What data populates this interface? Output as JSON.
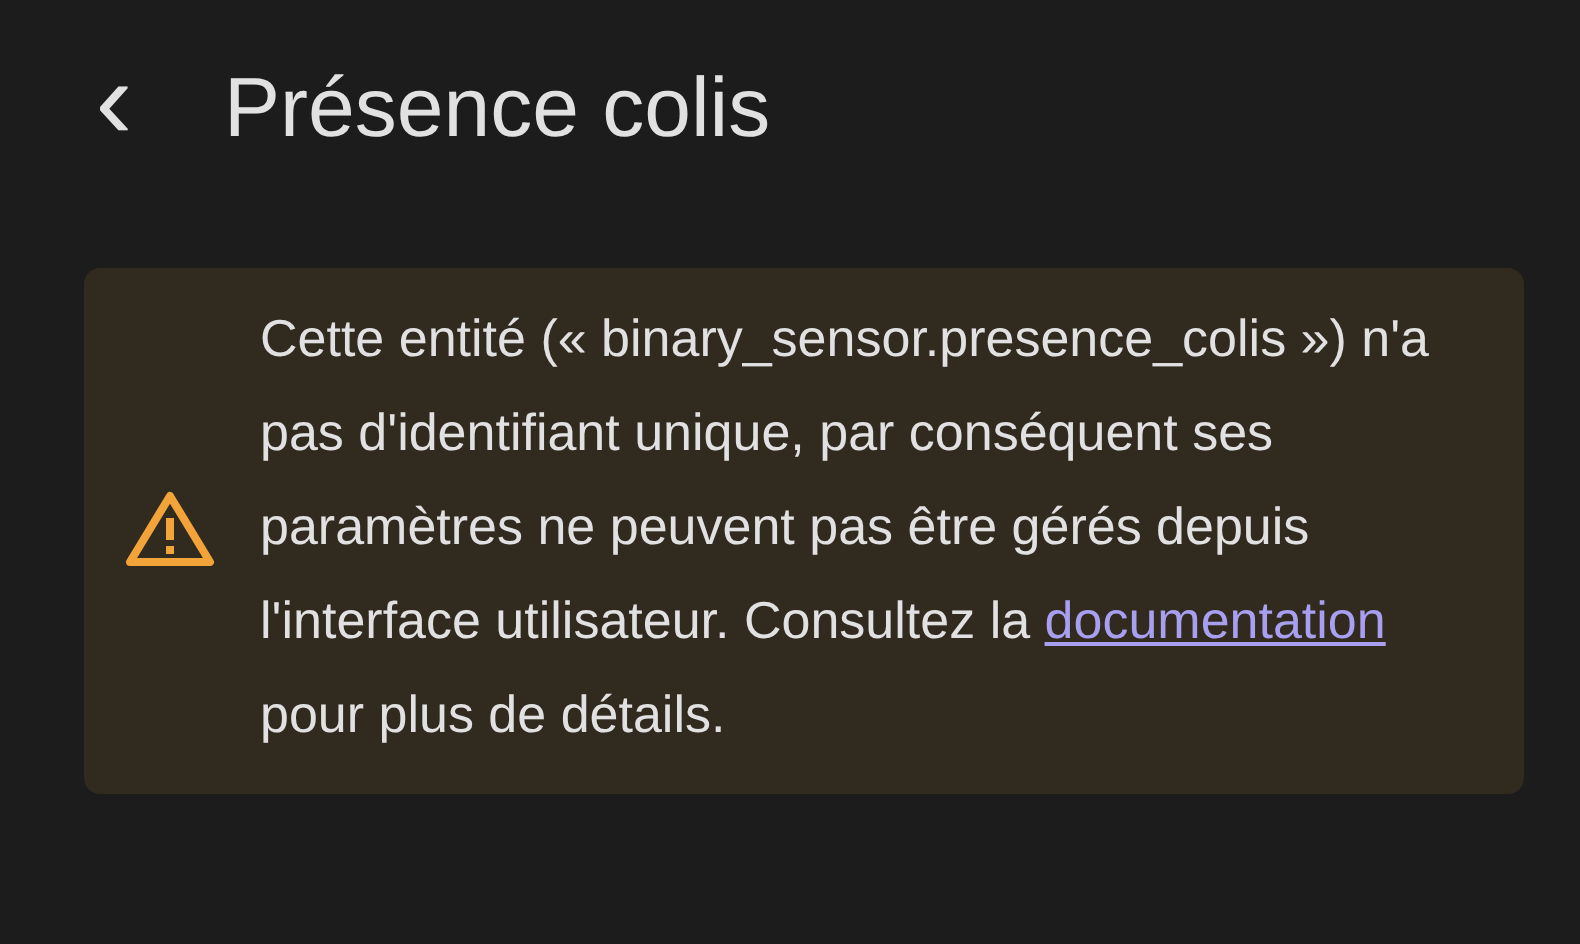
{
  "header": {
    "back_icon": "‹",
    "title": "Présence colis"
  },
  "alert": {
    "kind": "warning",
    "text_before": "Cette entité (« binary_sensor.presence_colis ») n'a pas d'identifiant unique, par conséquent ses paramètres ne peuvent pas être gérés depuis l'interface utilisateur. Consultez la ",
    "link": "documentation",
    "text_after": " pour plus de détails."
  }
}
